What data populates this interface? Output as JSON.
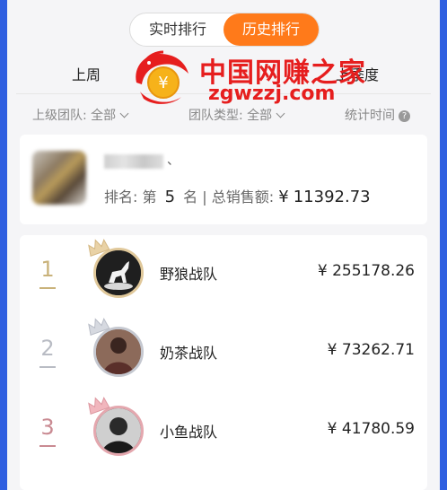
{
  "tabs": {
    "realtime": "实时排行",
    "history": "历史排行"
  },
  "periods": {
    "last_week": "上周",
    "last_quarter": "上季度"
  },
  "filters": {
    "parent_team_label": "上级团队:",
    "parent_team_value": "全部",
    "team_type_label": "团队类型:",
    "team_type_value": "全部",
    "stat_time_label": "统计时间",
    "help_glyph": "?"
  },
  "watermark": {
    "title": "中国网赚之家",
    "url": "zgwzzj.com",
    "logo_glyph": "¥"
  },
  "my_card": {
    "name_suffix": "、",
    "rank_prefix": "排名:  第",
    "rank_number": "5",
    "rank_suffix": "名 | 总销售额:",
    "currency": "¥",
    "total_sales": "11392.73"
  },
  "leaderboard": [
    {
      "rank": "1",
      "name": "野狼战队",
      "amount": "¥ 255178.26",
      "rank_color": "#c9b27a",
      "frame_color": "#e0c89a"
    },
    {
      "rank": "2",
      "name": "奶茶战队",
      "amount": "¥ 73262.71",
      "rank_color": "#b9bcc4",
      "frame_color": "#c5c8d0"
    },
    {
      "rank": "3",
      "name": "小鱼战队",
      "amount": "¥ 41780.59",
      "rank_color": "#c98a92",
      "frame_color": "#e4a7ae"
    }
  ]
}
